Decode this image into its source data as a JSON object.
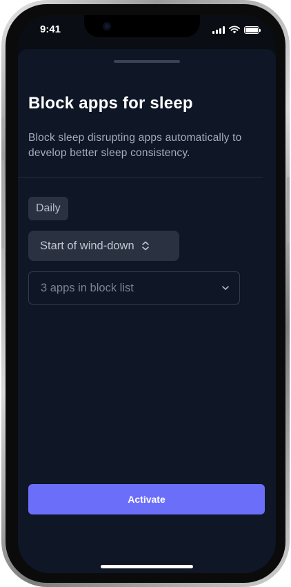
{
  "status_bar": {
    "time": "9:41"
  },
  "sheet": {
    "title": "Block apps for sleep",
    "description": "Block sleep disrupting apps automatically to develop better sleep consistency.",
    "frequency_chip": "Daily",
    "trigger_select": {
      "value": "Start of wind-down"
    },
    "block_list_dropdown": {
      "value": "3 apps in block list"
    },
    "activate_label": "Activate"
  },
  "colors": {
    "sheet_background": "#0f1626",
    "accent": "#6b6ef9",
    "control_background": "#2a3140"
  },
  "icons": {
    "trigger_select": "chevron-up-down-icon",
    "block_list_dropdown": "chevron-down-icon"
  }
}
